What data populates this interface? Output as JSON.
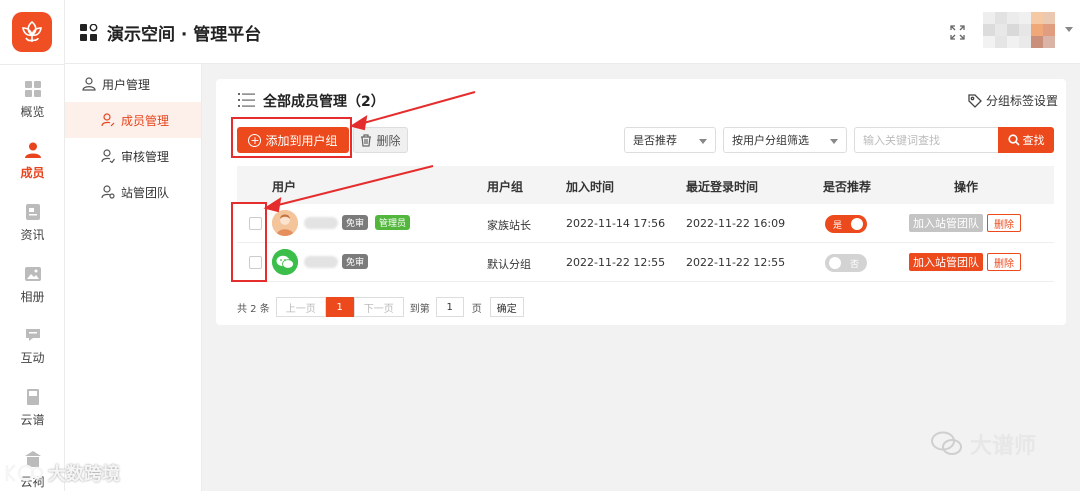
{
  "app": {
    "title": "演示空间 · 管理平台",
    "accent": "#ec4a1c"
  },
  "rail": {
    "items": [
      {
        "label": "概览",
        "icon": "grid-icon"
      },
      {
        "label": "成员",
        "icon": "person-icon"
      },
      {
        "label": "资讯",
        "icon": "news-icon"
      },
      {
        "label": "相册",
        "icon": "image-icon"
      },
      {
        "label": "互动",
        "icon": "chat-icon"
      },
      {
        "label": "云谱",
        "icon": "book-icon"
      },
      {
        "label": "云祠",
        "icon": "temple-icon"
      }
    ]
  },
  "subnav": {
    "group": "用户管理",
    "items": [
      {
        "label": "成员管理"
      },
      {
        "label": "审核管理"
      },
      {
        "label": "站管团队"
      }
    ]
  },
  "card": {
    "title": "全部成员管理（2）",
    "tag_settings": "分组标签设置",
    "add_button": "添加到用户组",
    "delete_button": "删除",
    "filter_recommend": "是否推荐",
    "filter_group": "按用户分组筛选",
    "search_placeholder": "输入关键词查找",
    "search_button": "查找"
  },
  "table": {
    "headers": [
      "用户",
      "用户组",
      "加入时间",
      "最近登录时间",
      "是否推荐",
      "操作"
    ],
    "rows": [
      {
        "badges": [
          "免审",
          "管理员"
        ],
        "group": "家族站长",
        "joined": "2022-11-14 17:56",
        "last_login": "2022-11-22 16:09",
        "recommend": "是",
        "team_action": "加入站管团队",
        "delete_action": "删除"
      },
      {
        "badges": [
          "免审"
        ],
        "group": "默认分组",
        "joined": "2022-11-22 12:55",
        "last_login": "2022-11-22 12:55",
        "recommend": "否",
        "team_action": "加入站管团队",
        "delete_action": "删除"
      }
    ]
  },
  "pagination": {
    "total": "共 2 条",
    "prev": "上一页",
    "current": "1",
    "next": "下一页",
    "goto_prefix": "到第",
    "goto_value": "1",
    "goto_suffix": "页",
    "confirm": "确定"
  },
  "watermarks": {
    "right": "大谱师",
    "left": "大数跨境"
  }
}
